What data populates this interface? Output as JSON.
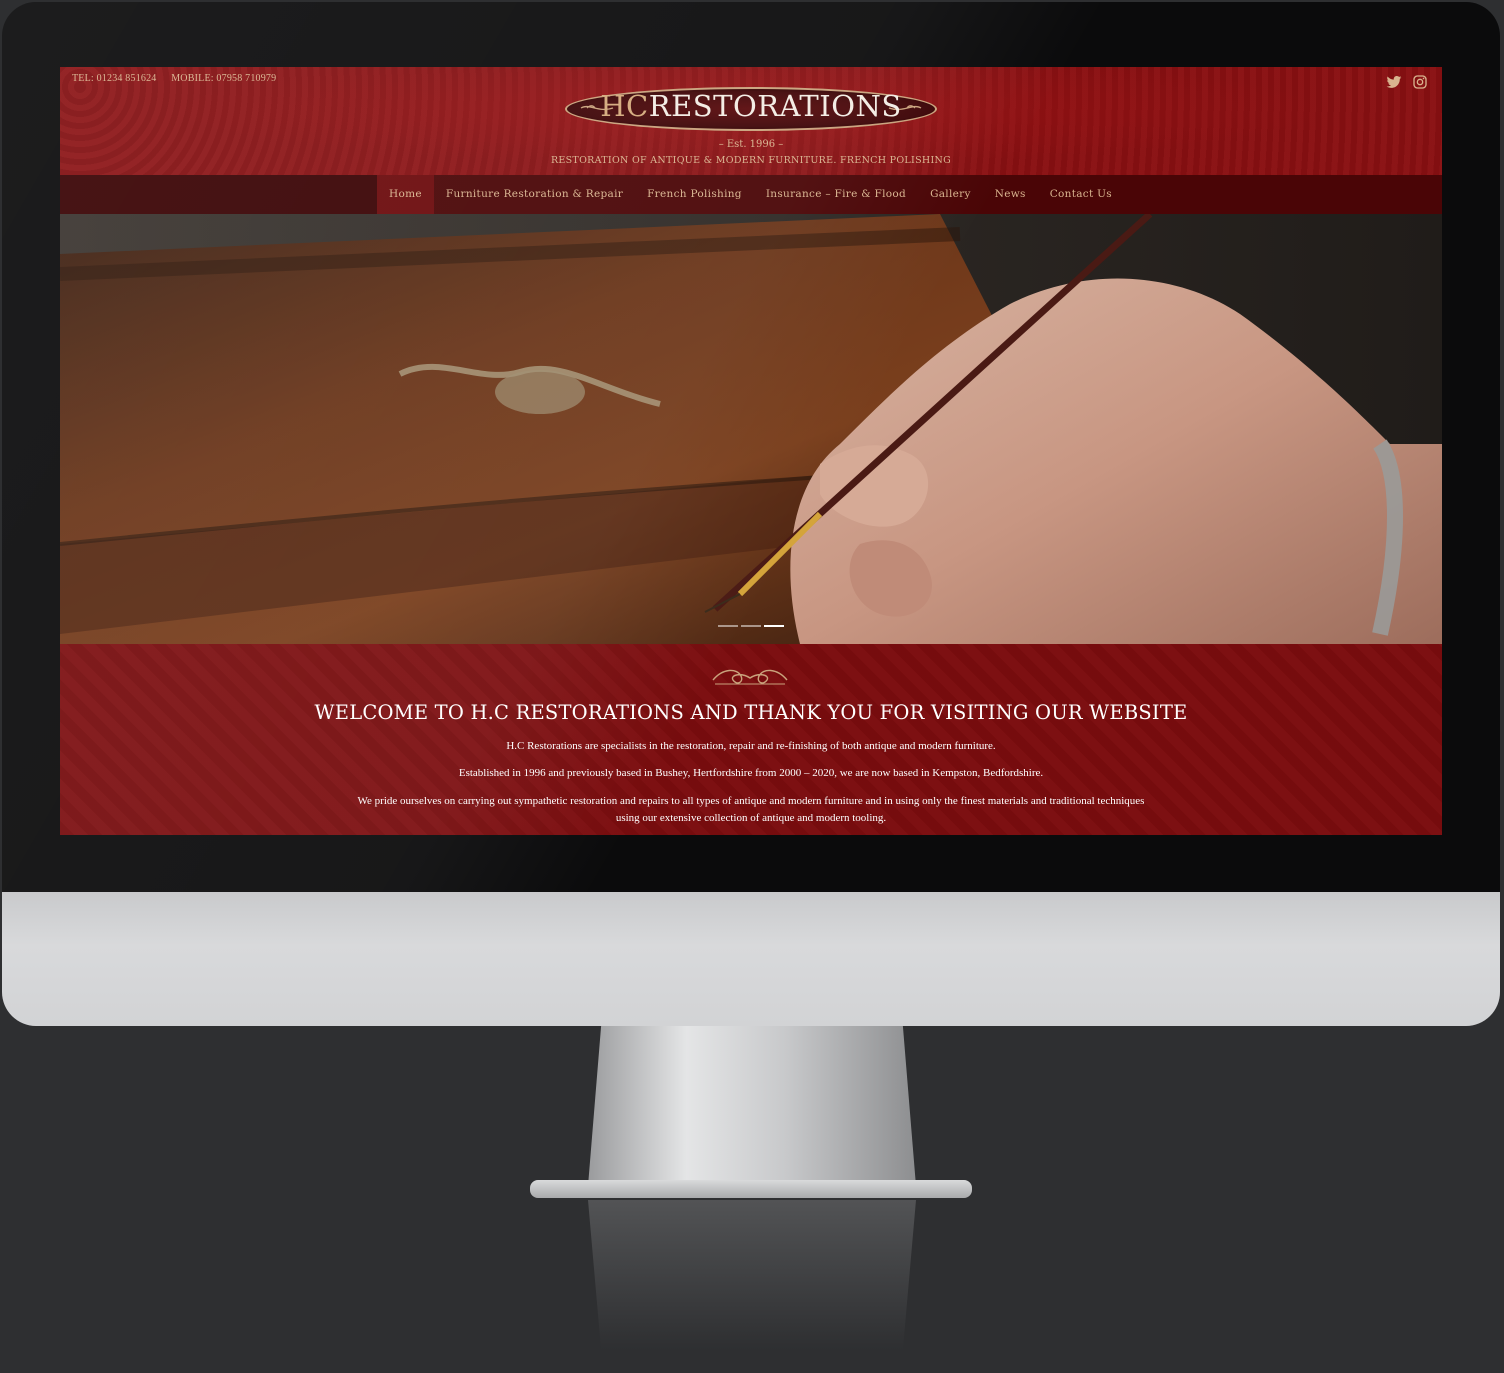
{
  "header": {
    "tel": "TEL: 01234 851624",
    "mobile": "MOBILE: 07958 710979",
    "logo_hc": "HC",
    "logo_rest": "RESTORATIONS",
    "est": "– Est. 1996 –",
    "tagline": "RESTORATION OF ANTIQUE & MODERN FURNITURE. FRENCH POLISHING",
    "social": [
      "twitter-icon",
      "instagram-icon"
    ],
    "accent_color": "#d9b48f"
  },
  "nav": {
    "items": [
      {
        "label": "Home",
        "active": true
      },
      {
        "label": "Furniture Restoration & Repair"
      },
      {
        "label": "French Polishing"
      },
      {
        "label": "Insurance – Fire & Flood"
      },
      {
        "label": "Gallery"
      },
      {
        "label": "News"
      },
      {
        "label": "Contact Us"
      }
    ]
  },
  "hero": {
    "slides": 3,
    "active_slide": 3
  },
  "welcome": {
    "title": "WELCOME TO H.C RESTORATIONS AND THANK YOU FOR VISITING OUR WEBSITE",
    "paragraphs": [
      "H.C Restorations are specialists in the restoration, repair and re-finishing of both antique and modern furniture.",
      "Established in 1996 and previously based in Bushey, Hertfordshire from 2000 – 2020, we are now based in Kempston, Bedfordshire.",
      "We pride ourselves on carrying out sympathetic restoration and repairs to all types of antique and modern furniture and in using only the finest materials and traditional techniques using our extensive collection of antique and modern tooling."
    ]
  }
}
